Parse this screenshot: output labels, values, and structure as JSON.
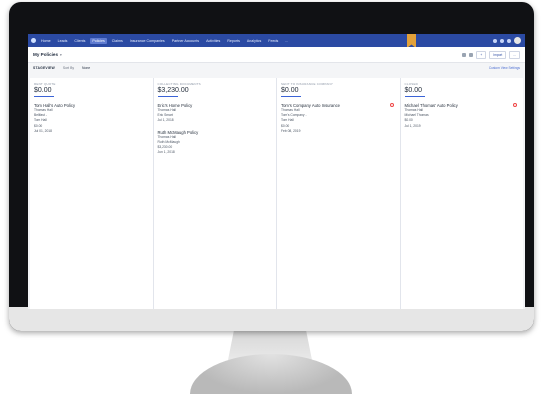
{
  "topnav": {
    "items": [
      "Home",
      "Leads",
      "Clients",
      "Policies",
      "Claims",
      "Insurance Companies",
      "Partner Accounts",
      "Activities",
      "Reports",
      "Analytics",
      "Feeds",
      "..."
    ],
    "active_index": 3
  },
  "header": {
    "title": "My Policies",
    "import_label": "Import",
    "more_label": "..."
  },
  "toolbar": {
    "view_label": "STAGEVIEW",
    "sort_label": "Sort By",
    "sort_value": "None",
    "right_link": "Custom View Settings"
  },
  "columns": [
    {
      "stage": "RENT QUOTE",
      "amount": "$0.00",
      "cards": [
        {
          "title": "Tom Hall's Auto Policy",
          "lines": [
            "Thomas Hall",
            "Bellfast -",
            "Tom Hall",
            "$0.00",
            "Jul 01, 2018"
          ]
        }
      ]
    },
    {
      "stage": "COLLECTING DOCUMENTS",
      "amount": "$3,230.00",
      "cards": [
        {
          "title": "Eric's Home Policy",
          "lines": [
            "Thomas Hall",
            "Eric Smart",
            "Jul 1, 2018"
          ]
        },
        {
          "title": "Ruth McMaugh Policy",
          "lines": [
            "Thomas Hall",
            "Ruth McMaugh",
            "$3,230.00",
            "Jun 1, 2018"
          ]
        }
      ]
    },
    {
      "stage": "SENT TO INSURANCE COMPANY",
      "amount": "$0.00",
      "cards": [
        {
          "title": "Tom's Company Auto Insurance",
          "lines": [
            "Thomas Hall",
            "Tom's Company -",
            "Tom Hall",
            "$0.00",
            "Feb 08, 2019"
          ]
        }
      ]
    },
    {
      "stage": "CLOSED",
      "amount": "$0.00",
      "cards": [
        {
          "title": "Michael Thomas' Auto Policy",
          "lines": [
            "Thomas Hall",
            "Michael Thomas",
            "$0.00",
            "Jul 1, 2019"
          ]
        }
      ]
    }
  ]
}
